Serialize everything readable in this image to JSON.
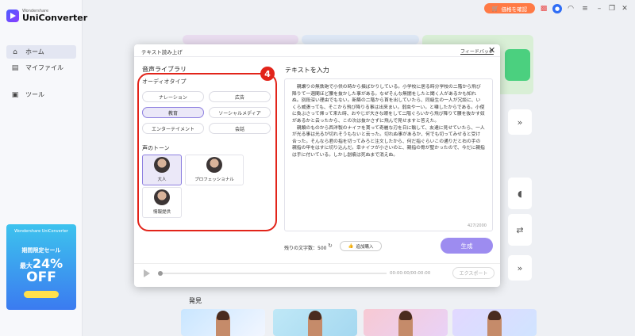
{
  "app": {
    "brand_small": "Wondershare",
    "brand_name": "UniConverter"
  },
  "sidebar": {
    "items": [
      {
        "label": "ホーム",
        "icon": "home-icon"
      },
      {
        "label": "マイファイル",
        "icon": "folder-icon"
      },
      {
        "label": "ツール",
        "icon": "toolbox-icon"
      }
    ],
    "promo": {
      "brand": "Wondershare UniConverter",
      "title": "期間限定セール",
      "max": "最大",
      "percent": "24%",
      "off": "OFF"
    }
  },
  "topbar": {
    "price_button": "価格を確認"
  },
  "main": {
    "discover": "発見"
  },
  "dialog": {
    "title": "テキスト読み上げ",
    "feedback": "フィードバック",
    "library_title": "音声ライブラリ",
    "audio_type_label": "オーディオタイプ",
    "audio_types": [
      "ナレーション",
      "広告",
      "教育",
      "ソーシャルメディア",
      "エンターテイメント",
      "会話"
    ],
    "selected_audio_type": "教育",
    "tone_label": "声のトーン",
    "voices": [
      "大人",
      "プロフェッショナル",
      "情報提供"
    ],
    "selected_voice": "大人",
    "text_title": "テキストを入力",
    "text_para1": "親譲りの無鉄砲で小供の時から損ばかりしている。小学校に居る時分学校の二階から飛び降りて一週間ほど腰を抜かした事がある。なぜそんな無闇をしたと聞く人があるかも知れぬ。別段深い理由でもない。新築の二階から首を出していたら、同級生の一人が冗談に、いくら威張っても、そこから飛び降りる事は出来まい。弱虫やーい。と囃したからである。小使に負ぶさって帰って来た時、おやじが大きな眼をして二階ぐらいから飛び降りて腰を抜かす奴があるかと云ったから、この次は抜かさずに飛んで見せますと答えた。",
    "text_para2": "親類のものから西洋製のナイフを貰って奇麗な刃を日に翳して、友達に見せていたら、一人が光る事は光るが切れそうもないと云った。切れぬ事があるか、何でも切ってみせると受け合った。そんなら君の指を切ってみろと注文したから、何だ指ぐらいこの通りだと右の手の親指の甲をはすに切り込んだ。幸ナイフが小さいのと、親指の骨が堅かったので、今だに親指は手に付いている。しかし創痕は死ぬまで消えぬ。",
    "char_count": "427/2000",
    "remaining_chars": "残りの文字数：500",
    "buy_more": "追加購入",
    "generate": "生成",
    "time": "00:00:00/00:00:00",
    "export": "エクスポート",
    "step_number": "4"
  },
  "colors": {
    "accent": "#9d8cf0",
    "highlight": "#e2241a",
    "price_button": "#ff7a45"
  }
}
